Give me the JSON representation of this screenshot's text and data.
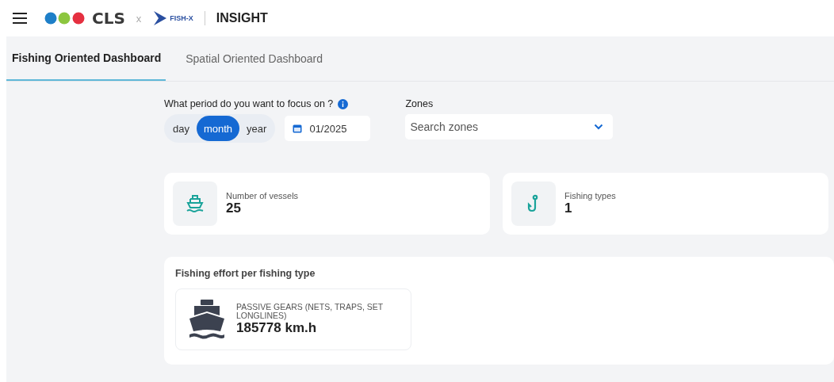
{
  "header": {
    "brand_main": "CLS",
    "separator": "x",
    "brand_partner": "FISH-X",
    "product": "INSIGHT"
  },
  "tabs": [
    {
      "label": "Fishing Oriented Dashboard",
      "selected": true
    },
    {
      "label": "Spatial Oriented Dashboard",
      "selected": false
    }
  ],
  "period": {
    "label": "What period do you want to focus on ?",
    "options": [
      {
        "label": "day",
        "selected": false
      },
      {
        "label": "month",
        "selected": true
      },
      {
        "label": "year",
        "selected": false
      }
    ],
    "date": "01/2025"
  },
  "zones": {
    "label": "Zones",
    "placeholder": "Search zones"
  },
  "stats": [
    {
      "kind": "ship",
      "label": "Number of vessels",
      "value": "25"
    },
    {
      "kind": "hook",
      "label": "Fishing types",
      "value": "1"
    }
  ],
  "effort": {
    "title": "Fishing effort per fishing type",
    "items": [
      {
        "label": "PASSIVE GEARS (NETS, TRAPS, SET LONGLINES)",
        "value": "185778 km.h"
      }
    ]
  }
}
